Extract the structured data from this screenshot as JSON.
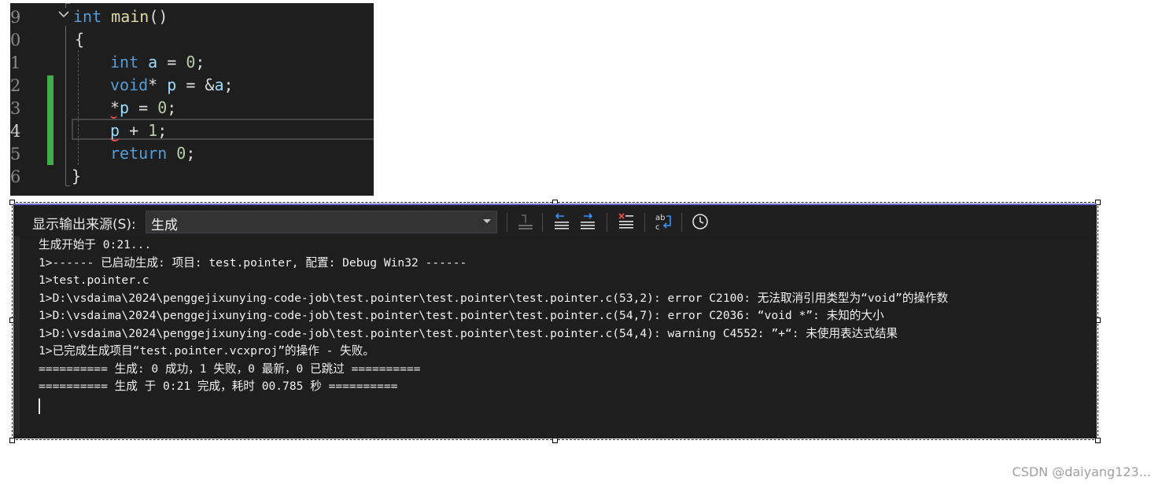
{
  "editor": {
    "line_numbers": [
      "9",
      "0",
      "1",
      "2",
      "3",
      "4",
      "5",
      "6"
    ],
    "code": [
      {
        "tokens": [
          {
            "t": "int",
            "c": "kw"
          },
          {
            "t": " ",
            "c": "pl"
          },
          {
            "t": "main",
            "c": "fn"
          },
          {
            "t": "()",
            "c": "pl"
          }
        ]
      },
      {
        "tokens": [
          {
            "t": "{",
            "c": "pl"
          }
        ]
      },
      {
        "tokens": [
          {
            "t": "int",
            "c": "kw"
          },
          {
            "t": " ",
            "c": "pl"
          },
          {
            "t": "a",
            "c": "id"
          },
          {
            "t": " = ",
            "c": "pl"
          },
          {
            "t": "0",
            "c": "nm"
          },
          {
            "t": ";",
            "c": "pl"
          }
        ]
      },
      {
        "tokens": [
          {
            "t": "void",
            "c": "kw"
          },
          {
            "t": "* ",
            "c": "pl"
          },
          {
            "t": "p",
            "c": "id"
          },
          {
            "t": " = &",
            "c": "pl"
          },
          {
            "t": "a",
            "c": "id"
          },
          {
            "t": ";",
            "c": "pl"
          }
        ]
      },
      {
        "tokens": [
          {
            "t": "*",
            "c": "pl"
          },
          {
            "t": "p",
            "c": "id"
          },
          {
            "t": " = ",
            "c": "pl"
          },
          {
            "t": "0",
            "c": "nm"
          },
          {
            "t": ";",
            "c": "pl"
          }
        ]
      },
      {
        "tokens": [
          {
            "t": "p",
            "c": "id"
          },
          {
            "t": " + ",
            "c": "pl"
          },
          {
            "t": "1",
            "c": "nm"
          },
          {
            "t": ";",
            "c": "pl"
          }
        ]
      },
      {
        "tokens": [
          {
            "t": "return",
            "c": "kw"
          },
          {
            "t": " ",
            "c": "pl"
          },
          {
            "t": "0",
            "c": "nm"
          },
          {
            "t": ";",
            "c": "pl"
          }
        ]
      },
      {
        "tokens": [
          {
            "t": "}",
            "c": "pl"
          }
        ]
      }
    ]
  },
  "output_panel": {
    "source_label": "显示输出来源(S):",
    "source_value": "生成",
    "toolbar_icons": [
      "go-to-code-icon",
      "previous-message-icon",
      "next-message-icon",
      "clear-all-icon",
      "word-wrap-icon",
      "timestamp-icon"
    ],
    "lines": [
      "生成开始于 0:21...",
      "1>------ 已启动生成: 项目: test.pointer, 配置: Debug Win32 ------",
      "1>test.pointer.c",
      "1>D:\\vsdaima\\2024\\penggejixunying-code-job\\test.pointer\\test.pointer\\test.pointer.c(53,2): error C2100: 无法取消引用类型为“void”的操作数",
      "1>D:\\vsdaima\\2024\\penggejixunying-code-job\\test.pointer\\test.pointer\\test.pointer.c(54,7): error C2036: “void *”: 未知的大小",
      "1>D:\\vsdaima\\2024\\penggejixunying-code-job\\test.pointer\\test.pointer\\test.pointer.c(54,4): warning C4552: ”+“: 未使用表达式结果",
      "1>已完成生成项目“test.pointer.vcxproj”的操作 - 失败。",
      "========== 生成: 0 成功，1 失败，0 最新，0 已跳过 ==========",
      "========== 生成 于 0:21 完成，耗时 00.785 秒 =========="
    ]
  },
  "colors": {
    "keyword": "#569cd6",
    "identifier": "#9cdcfe",
    "function": "#dcdcaa",
    "number": "#b5cea8",
    "change_bar": "#3fae49",
    "error_squiggle": "#f14c4c"
  },
  "watermark": "CSDN @daiyang123..."
}
